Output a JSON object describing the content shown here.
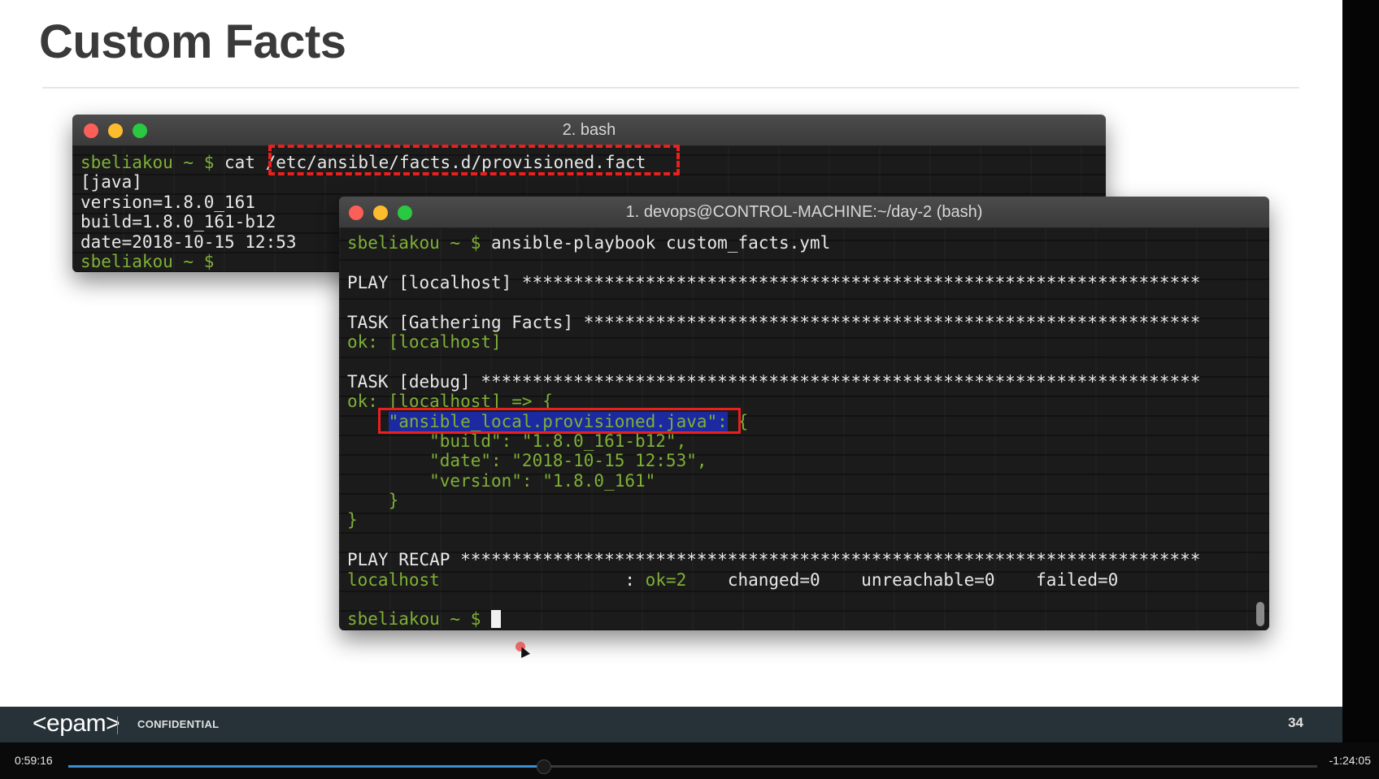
{
  "slide": {
    "title": "Custom Facts",
    "footer": {
      "logo": "<epam>",
      "confidential": "CONFIDENTIAL",
      "page_number": "34"
    }
  },
  "back_terminal": {
    "title": "2. bash",
    "lines": [
      {
        "prompt": "sbeliakou ~ $",
        "text": " cat ",
        "path": "/etc/ansible/facts.d/provisioned.fact"
      },
      {
        "text": "[java]"
      },
      {
        "text": "version=1.8.0_161"
      },
      {
        "text": "build=1.8.0_161-b12"
      },
      {
        "text": "date=2018-10-15 12:53"
      },
      {
        "prompt": "sbeliakou ~ $",
        "text": ""
      }
    ]
  },
  "front_terminal": {
    "title": "1. devops@CONTROL-MACHINE:~/day-2 (bash)",
    "prompt": "sbeliakou ~ $",
    "command": " ansible-playbook custom_facts.yml",
    "play": "PLAY [localhost] ******************************************************************",
    "task_facts": "TASK [Gathering Facts] ************************************************************",
    "ok_facts": "ok: [localhost]",
    "task_debug": "TASK [debug] **********************************************************************",
    "ok_debug": "ok: [localhost] => {",
    "key_indent": "    ",
    "key": "\"ansible_local.provisioned.java\":",
    "key_brace": " {",
    "build": "        \"build\": \"1.8.0_161-b12\",",
    "date": "        \"date\": \"2018-10-15 12:53\",",
    "version": "        \"version\": \"1.8.0_161\"",
    "close_inner": "    }",
    "close_outer": "}",
    "recap": "PLAY RECAP ************************************************************************",
    "recap_host": "localhost",
    "recap_sep": "                  : ",
    "recap_ok": "ok=2",
    "recap_rest": "    changed=0    unreachable=0    failed=0"
  },
  "player": {
    "elapsed": "0:59:16",
    "remaining": "-1:24:05",
    "progress": 0.38
  }
}
